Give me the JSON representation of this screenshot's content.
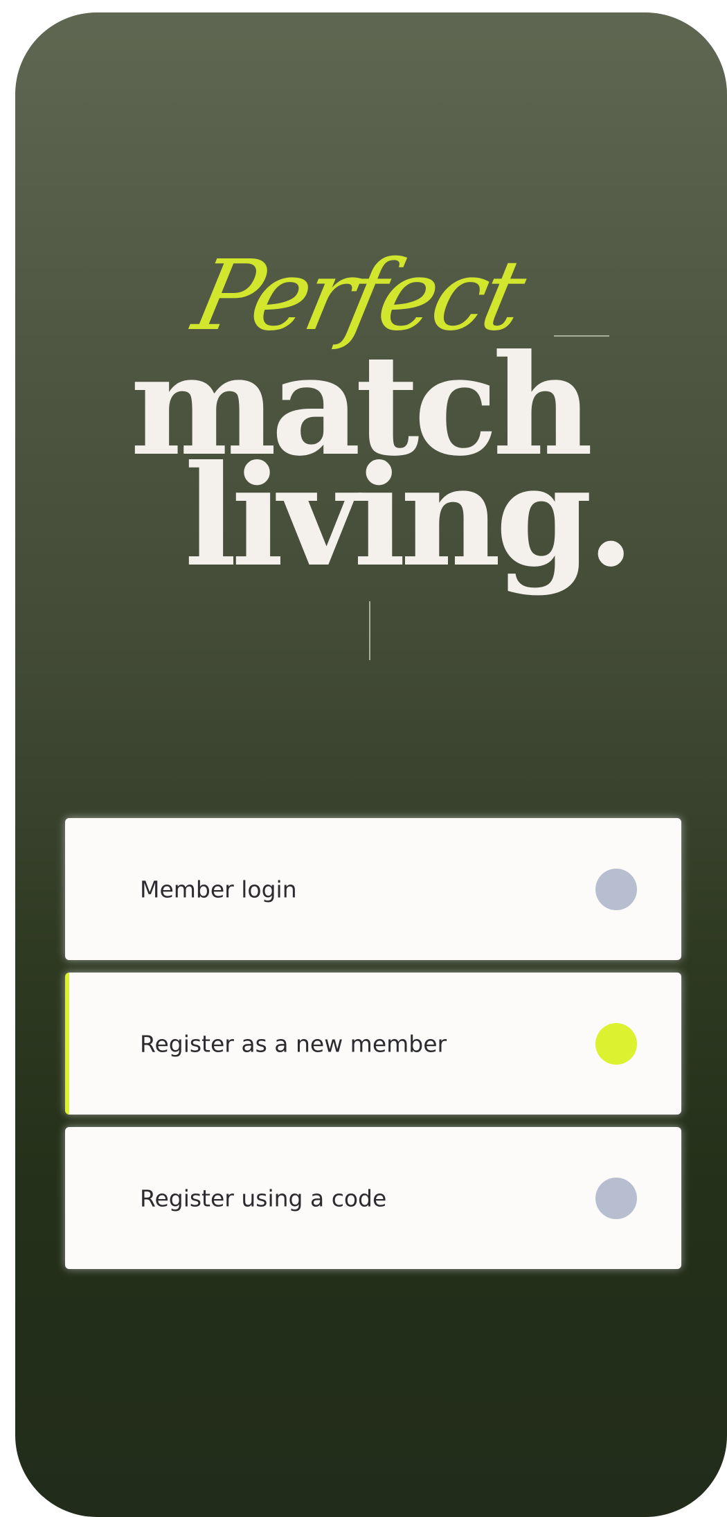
{
  "brand": {
    "script": "Perfect",
    "line1": "match",
    "line2": "living."
  },
  "options": [
    {
      "label": "Member login",
      "selected": false
    },
    {
      "label": "Register as a new member",
      "selected": true
    },
    {
      "label": "Register using a code",
      "selected": false
    }
  ],
  "colors": {
    "accent": "#dcf12f",
    "radio_inactive": "#b7bed0",
    "background_top": "#5f6752",
    "background_bottom": "#222c1b",
    "card": "#fcfbfa",
    "brand_text": "#f4f1ec"
  }
}
